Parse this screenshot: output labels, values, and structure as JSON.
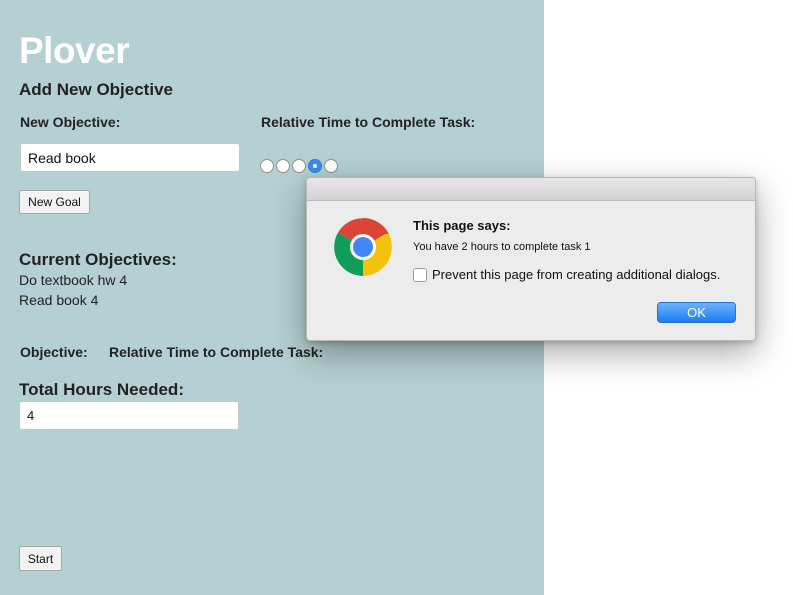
{
  "app": {
    "title": "Plover",
    "add_heading": "Add New Objective",
    "new_objective_label": "New Objective:",
    "new_objective_value": "Read book",
    "relative_time_label": "Relative Time to Complete Task:",
    "time_options": [
      1,
      2,
      3,
      4,
      5
    ],
    "time_selected": 4,
    "new_goal_button": "New Goal",
    "current_heading": "Current Objectives:",
    "current_objectives": [
      "Do textbook hw 4",
      "Read book 4"
    ],
    "table_headers": {
      "objective": "Objective:",
      "relative_time": "Relative Time to Complete Task:"
    },
    "total_hours_heading": "Total Hours Needed:",
    "total_hours_value": "4",
    "start_button": "Start",
    "panel_color": "#b5d0d2"
  },
  "dialog": {
    "title": "This page says:",
    "message": "You have 2 hours to complete task 1",
    "checkbox_label": "Prevent this page from creating additional dialogs.",
    "checkbox_checked": false,
    "ok_button": "OK",
    "icon": "chrome-logo-icon",
    "button_color": "#1b7cf4"
  }
}
